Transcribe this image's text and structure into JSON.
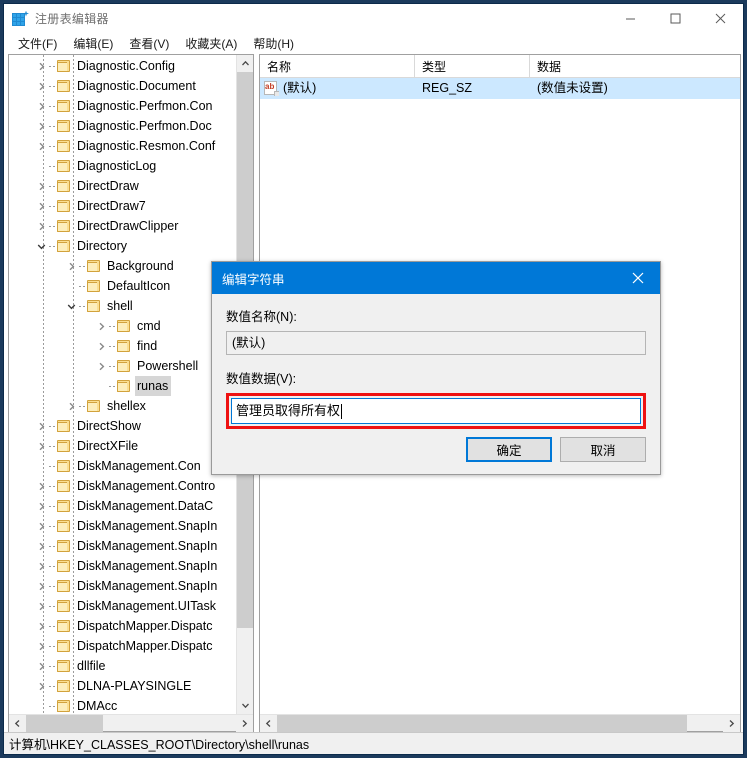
{
  "window": {
    "title": "注册表编辑器",
    "icon": "registry-icon",
    "controls": {
      "minimize": "−",
      "maximize": "□",
      "close": "✕"
    }
  },
  "menubar": {
    "items": [
      {
        "label": "文件(F)",
        "name": "menu-file"
      },
      {
        "label": "编辑(E)",
        "name": "menu-edit"
      },
      {
        "label": "查看(V)",
        "name": "menu-view"
      },
      {
        "label": "收藏夹(A)",
        "name": "menu-favorites"
      },
      {
        "label": "帮助(H)",
        "name": "menu-help"
      }
    ]
  },
  "tree": {
    "nodes": [
      {
        "label": "Diagnostic.Config",
        "depth": 2,
        "expander": "collapsed",
        "selected": false
      },
      {
        "label": "Diagnostic.Document",
        "depth": 2,
        "expander": "collapsed",
        "selected": false
      },
      {
        "label": "Diagnostic.Perfmon.Con",
        "depth": 2,
        "expander": "collapsed",
        "selected": false
      },
      {
        "label": "Diagnostic.Perfmon.Doc",
        "depth": 2,
        "expander": "collapsed",
        "selected": false
      },
      {
        "label": "Diagnostic.Resmon.Conf",
        "depth": 2,
        "expander": "collapsed",
        "selected": false
      },
      {
        "label": "DiagnosticLog",
        "depth": 2,
        "expander": "none",
        "selected": false
      },
      {
        "label": "DirectDraw",
        "depth": 2,
        "expander": "collapsed",
        "selected": false
      },
      {
        "label": "DirectDraw7",
        "depth": 2,
        "expander": "collapsed",
        "selected": false
      },
      {
        "label": "DirectDrawClipper",
        "depth": 2,
        "expander": "collapsed",
        "selected": false
      },
      {
        "label": "Directory",
        "depth": 2,
        "expander": "expanded",
        "selected": false
      },
      {
        "label": "Background",
        "depth": 3,
        "expander": "collapsed",
        "selected": false
      },
      {
        "label": "DefaultIcon",
        "depth": 3,
        "expander": "none",
        "selected": false
      },
      {
        "label": "shell",
        "depth": 3,
        "expander": "expanded",
        "selected": false
      },
      {
        "label": "cmd",
        "depth": 4,
        "expander": "collapsed",
        "selected": false
      },
      {
        "label": "find",
        "depth": 4,
        "expander": "collapsed",
        "selected": false
      },
      {
        "label": "Powershell",
        "depth": 4,
        "expander": "collapsed",
        "selected": false
      },
      {
        "label": "runas",
        "depth": 4,
        "expander": "none",
        "selected": true
      },
      {
        "label": "shellex",
        "depth": 3,
        "expander": "collapsed",
        "selected": false
      },
      {
        "label": "DirectShow",
        "depth": 2,
        "expander": "collapsed",
        "selected": false
      },
      {
        "label": "DirectXFile",
        "depth": 2,
        "expander": "collapsed",
        "selected": false
      },
      {
        "label": "DiskManagement.Con",
        "depth": 2,
        "expander": "none",
        "selected": false
      },
      {
        "label": "DiskManagement.Contro",
        "depth": 2,
        "expander": "collapsed",
        "selected": false
      },
      {
        "label": "DiskManagement.DataC",
        "depth": 2,
        "expander": "collapsed",
        "selected": false
      },
      {
        "label": "DiskManagement.SnapIn",
        "depth": 2,
        "expander": "collapsed",
        "selected": false
      },
      {
        "label": "DiskManagement.SnapIn",
        "depth": 2,
        "expander": "collapsed",
        "selected": false
      },
      {
        "label": "DiskManagement.SnapIn",
        "depth": 2,
        "expander": "collapsed",
        "selected": false
      },
      {
        "label": "DiskManagement.SnapIn",
        "depth": 2,
        "expander": "collapsed",
        "selected": false
      },
      {
        "label": "DiskManagement.UITask",
        "depth": 2,
        "expander": "collapsed",
        "selected": false
      },
      {
        "label": "DispatchMapper.Dispatc",
        "depth": 2,
        "expander": "collapsed",
        "selected": false
      },
      {
        "label": "DispatchMapper.Dispatc",
        "depth": 2,
        "expander": "collapsed",
        "selected": false
      },
      {
        "label": "dllfile",
        "depth": 2,
        "expander": "collapsed",
        "selected": false
      },
      {
        "label": "DLNA-PLAYSINGLE",
        "depth": 2,
        "expander": "collapsed",
        "selected": false
      },
      {
        "label": "DMAcc",
        "depth": 2,
        "expander": "none",
        "selected": false
      }
    ]
  },
  "list": {
    "columns": [
      "名称",
      "类型",
      "数据"
    ],
    "rows": [
      {
        "icon": "string-value-icon",
        "name": "(默认)",
        "type": "REG_SZ",
        "data": "(数值未设置)",
        "selected": true
      }
    ]
  },
  "statusbar": {
    "path": "计算机\\HKEY_CLASSES_ROOT\\Directory\\shell\\runas"
  },
  "dialog": {
    "title": "编辑字符串",
    "close_label": "✕",
    "name_label": "数值名称(N):",
    "name_value": "(默认)",
    "data_label": "数值数据(V):",
    "data_value": "管理员取得所有权",
    "ok_label": "确定",
    "cancel_label": "取消",
    "highlight_color": "#ee1111",
    "accent_color": "#0078d7"
  }
}
